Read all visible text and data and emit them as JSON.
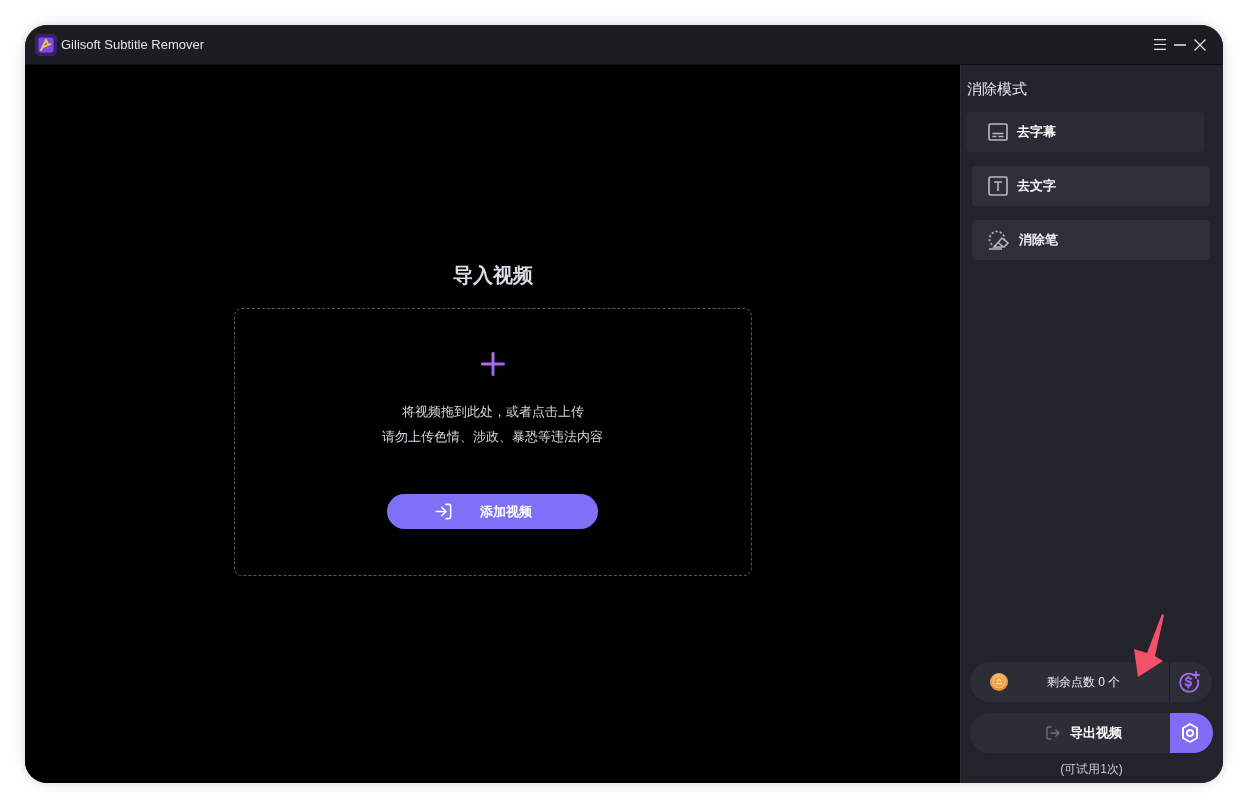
{
  "window": {
    "title": "Gilisoft Subtitle Remover"
  },
  "import": {
    "title": "导入视频",
    "hint_lines": [
      "将视频拖到此处，或者点击上传",
      "请勿上传色情、涉政、暴恐等违法内容"
    ],
    "button": "添加视频"
  },
  "sidebar": {
    "heading": "消除模式",
    "modes": [
      {
        "kind": "subtitle",
        "label": "去字幕",
        "selected": true
      },
      {
        "kind": "text",
        "label": "去文字",
        "selected": false
      },
      {
        "kind": "eraser",
        "label": "消除笔",
        "selected": false
      }
    ]
  },
  "points": {
    "label": "剩余点数 0 个"
  },
  "export": {
    "button": "导出视频",
    "note": "(可试用1次)"
  }
}
